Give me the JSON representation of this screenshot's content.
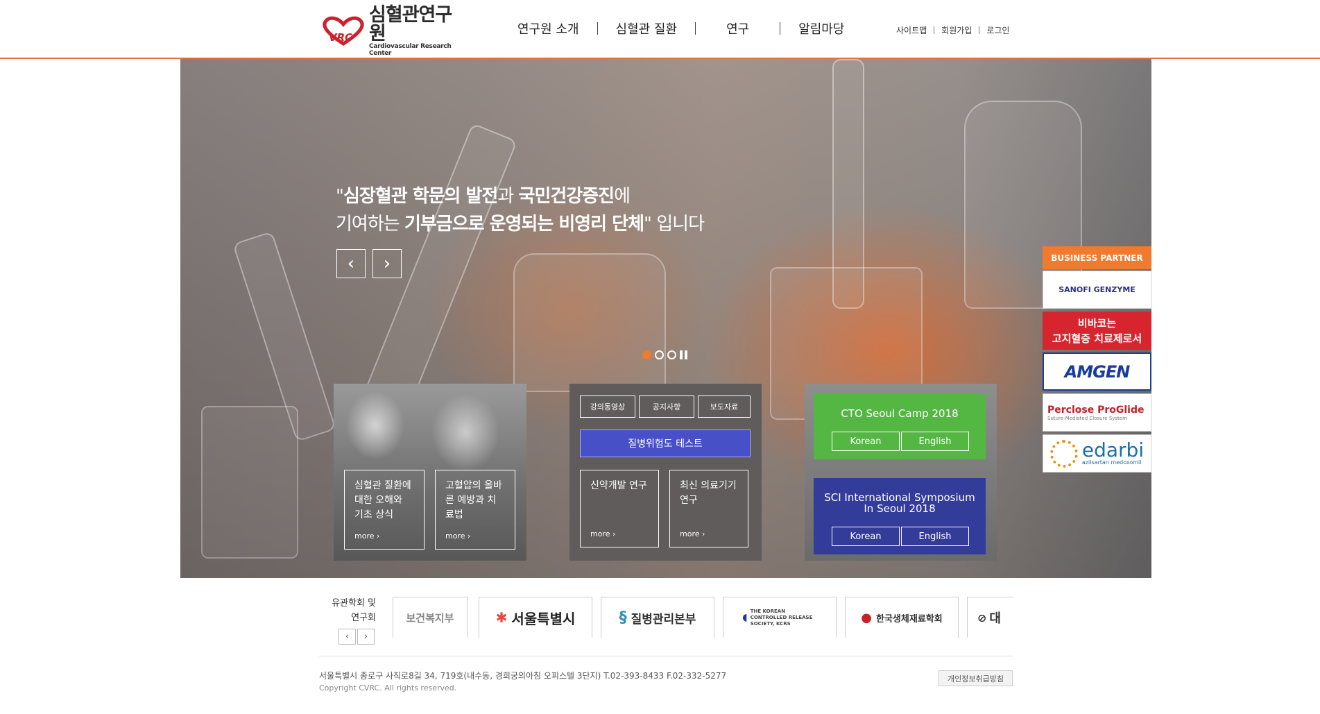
{
  "header": {
    "logo_ko": "심혈관연구원",
    "logo_en": "Cardiovascular Research Center",
    "logo_mark": "CVRC",
    "nav": [
      "연구원 소개",
      "심혈관 질환",
      "연구",
      "알림마당"
    ],
    "util": [
      "사이트맵",
      "회원가입",
      "로그인"
    ]
  },
  "hero": {
    "line1_pre": "\"",
    "line1_b1": "심장혈관 학문의 발전",
    "line1_mid": "과 ",
    "line1_b2": "국민건강증진",
    "line1_post": "에",
    "line2_pre": "기여하는 ",
    "line2_b": "기부금으로 운영되는 비영리 단체",
    "line2_post": "\" 입니다",
    "prev": "‹",
    "next": "›"
  },
  "panel_left": {
    "box1": "심혈관 질환에 대한 오해와 기초 상식",
    "box2": "고혈압의 올바른 예방과 치료법",
    "more": "more ›"
  },
  "panel_center": {
    "tabs": [
      "강의동영상",
      "공지사항",
      "보도자료"
    ],
    "risk_test": "질병위험도 테스트",
    "box1": "신약개발 연구",
    "box2": "최신 의료기기 연구",
    "more": "more ›"
  },
  "panel_right": {
    "card1_title": "CTO Seoul Camp 2018",
    "card2_title_1": "SCI International Symposium",
    "card2_title_2": "In Seoul 2018",
    "korean": "Korean",
    "english": "English"
  },
  "partner": {
    "heading": "BUSINESS PARTNER",
    "logos": [
      "SANOFI GENZYME",
      "비바코는",
      "고지혈증 치료제로서",
      "AMGEN",
      "Perclose ProGlide",
      "Suture-Mediated Closure System",
      "edarbi",
      "azilsartan medoxomil"
    ]
  },
  "family": {
    "label_1": "유관학회 및",
    "label_2": "연구회",
    "prev": "‹",
    "next": "›",
    "sites": [
      "보건복지부",
      "서울특별시",
      "질병관리본부",
      "THE KOREAN CONTROLLED RELEASE SOCIETY, KCRS",
      "한국생체재료학회",
      "대"
    ]
  },
  "footer": {
    "address": "서울특별시 종로구 사직로8길 34, 719호(내수동, 경희궁의아침 오피스텔 3단지) T.02-393-8433 F.02-332-5277",
    "copyright": "Copyright CVRC. All rights reserved.",
    "privacy": "개인정보취급방침"
  },
  "colors": {
    "accent": "#f07a2e",
    "green_card": "#55b743",
    "navy_card": "#343c9a",
    "risk_button": "#4850c8"
  }
}
